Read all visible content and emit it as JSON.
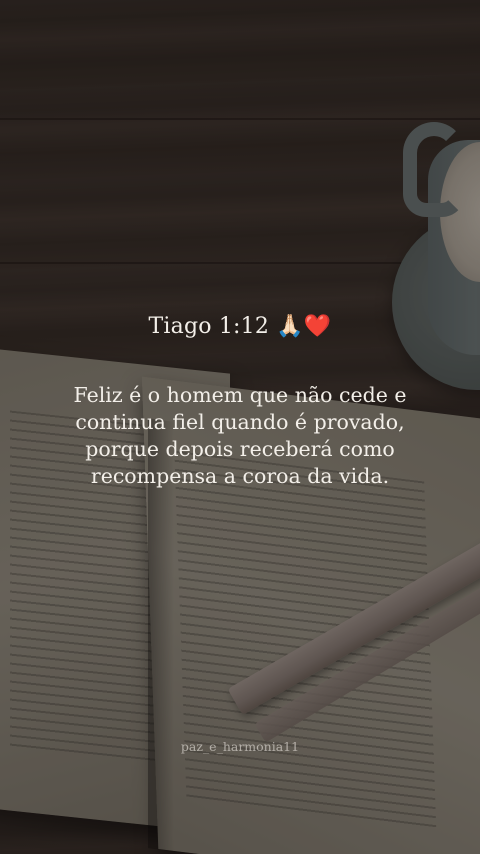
{
  "post": {
    "reference": "Tiago 1:12",
    "reference_emoji_hands": "🙏🏻",
    "reference_emoji_heart": "❤️",
    "verse_lines": [
      "Feliz é o homem que não cede e",
      "continua fiel quando é provado,",
      "porque depois receberá como",
      "recompensa a coroa da vida."
    ],
    "watermark": "paz_e_harmonia11"
  },
  "colors": {
    "text": "#f3efe9",
    "heart": "#e8121d",
    "background": "#3a312a"
  }
}
